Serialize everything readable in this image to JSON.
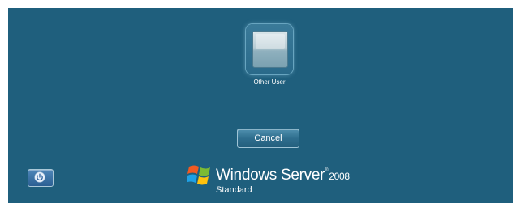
{
  "user_tile": {
    "label": "Other User",
    "icon": "user-tile-icon"
  },
  "buttons": {
    "cancel_label": "Cancel",
    "power_icon": "power-options-icon"
  },
  "branding": {
    "logo_icon": "windows-flag-icon",
    "product_name": "Windows Server",
    "trademark": "®",
    "version": "2008",
    "edition": "Standard"
  },
  "colors": {
    "background": "#1f5f7d",
    "text": "#ffffff"
  }
}
